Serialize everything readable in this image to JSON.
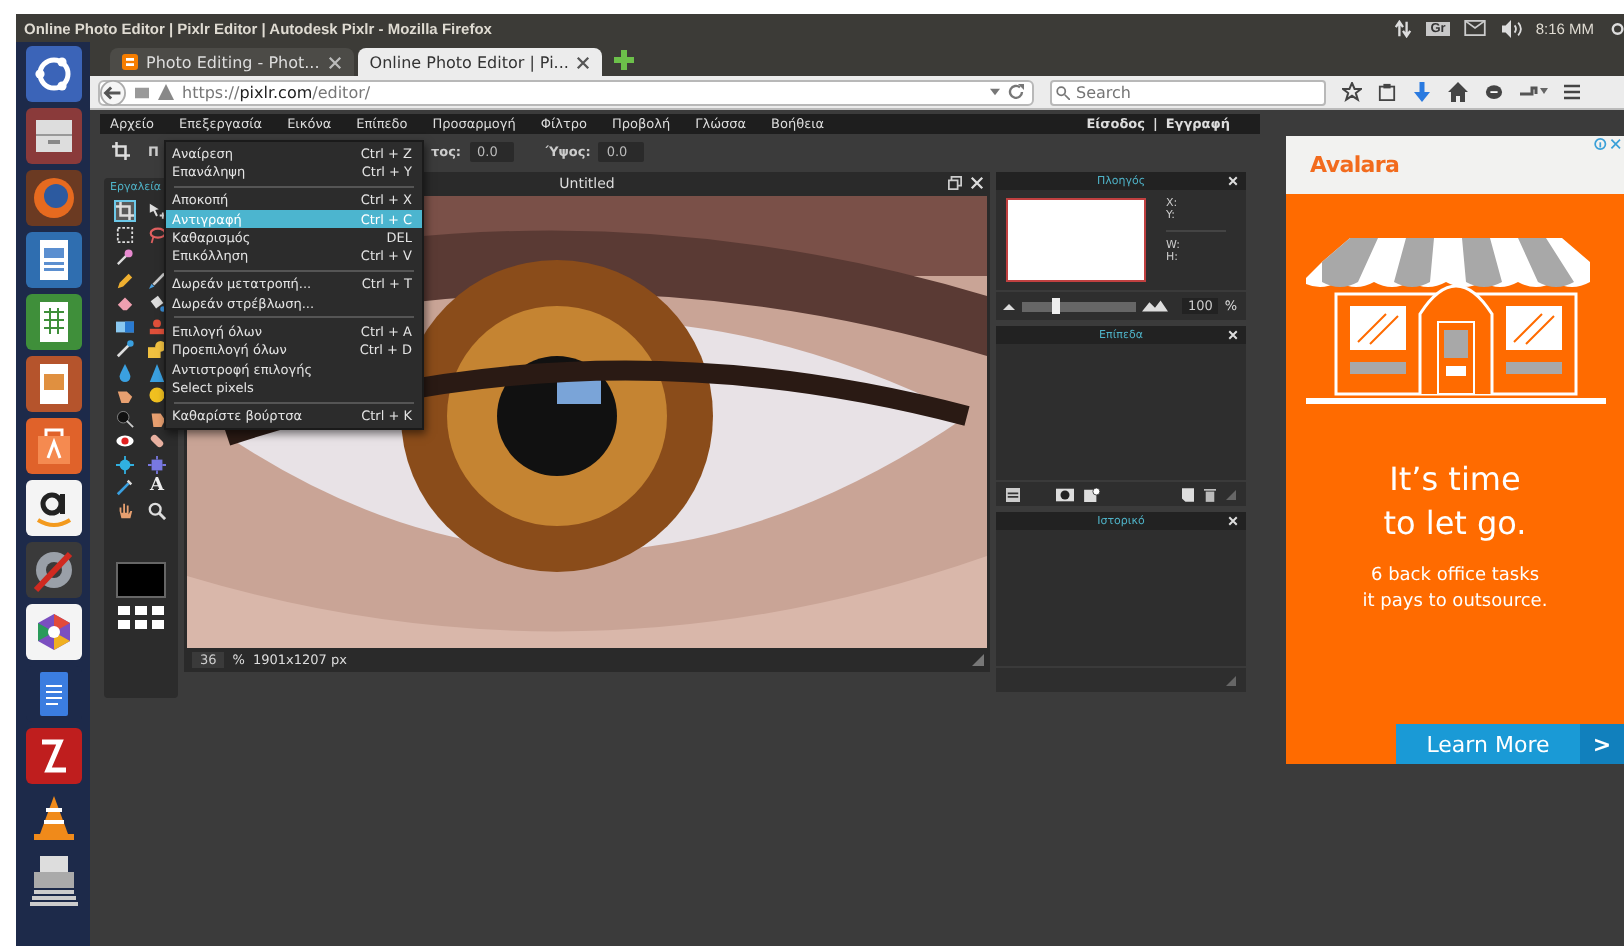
{
  "os_bar": {
    "title": "Online Photo Editor | Pixlr Editor | Autodesk Pixlr - Mozilla Firefox",
    "keyboard": "Gr",
    "clock": "8:16 ΜΜ"
  },
  "browser": {
    "tabs": [
      {
        "label": "Photo Editing - Phot...",
        "selected": false
      },
      {
        "label": "Online Photo Editor | Pi...",
        "selected": true
      }
    ],
    "url": {
      "scheme": "https://",
      "host": "pixlr.com",
      "path": "/editor/"
    },
    "search": {
      "placeholder": "Search"
    }
  },
  "editor": {
    "menubar": [
      "Αρχείο",
      "Επεξεργασία",
      "Εικόνα",
      "Επίπεδο",
      "Προσαρμογή",
      "Φίλτρο",
      "Προβολή",
      "Γλώσσα",
      "Βοήθεια"
    ],
    "account": {
      "login": "Είσοδος",
      "divider": "|",
      "register": "Εγγραφή"
    },
    "options": {
      "label_1": "Π",
      "label_2": "τος:",
      "value_1": "0.0",
      "label_3": "Ύψος:",
      "value_2": "0.0"
    },
    "tools_title": "Εργαλεία",
    "tool_rows": [
      [
        {
          "kind": "crop",
          "selected": true
        },
        {
          "kind": "move",
          "selected": false
        }
      ],
      [
        {
          "kind": "marquee",
          "selected": false
        },
        {
          "kind": "lasso",
          "selected": false
        }
      ],
      [
        {
          "kind": "wand",
          "selected": false
        }
      ],
      [
        {
          "kind": "pencil",
          "selected": false
        },
        {
          "kind": "brush",
          "selected": false
        }
      ],
      [
        {
          "kind": "eraser",
          "selected": false
        },
        {
          "kind": "bucket",
          "selected": false
        }
      ],
      [
        {
          "kind": "gradient",
          "selected": false
        },
        {
          "kind": "stamp",
          "selected": false
        }
      ],
      [
        {
          "kind": "replace",
          "selected": false
        },
        {
          "kind": "shape",
          "selected": false
        }
      ],
      [
        {
          "kind": "blur",
          "selected": false
        },
        {
          "kind": "sharpen",
          "selected": false
        }
      ],
      [
        {
          "kind": "smudge",
          "selected": false
        },
        {
          "kind": "sponge",
          "selected": false
        }
      ],
      [
        {
          "kind": "dodge",
          "selected": false
        },
        {
          "kind": "burn",
          "selected": false
        }
      ],
      [
        {
          "kind": "redeye",
          "selected": false
        },
        {
          "kind": "heal",
          "selected": false
        }
      ],
      [
        {
          "kind": "bloat",
          "selected": false
        },
        {
          "kind": "pinch",
          "selected": false
        }
      ],
      [
        {
          "kind": "picker",
          "selected": false
        },
        {
          "kind": "type",
          "glyph": "A",
          "selected": false
        }
      ],
      [
        {
          "kind": "hand",
          "selected": false
        },
        {
          "kind": "zoom",
          "selected": false
        }
      ]
    ],
    "canvas": {
      "title": "Untitled",
      "zoom": "36",
      "zoom_unit": "%",
      "size": "1901x1207 px"
    },
    "navigator": {
      "title": "Πλοηγός",
      "x": "X:",
      "y": "Y:",
      "w": "W:",
      "h": "H:",
      "zoom": {
        "level": 0.3
      },
      "zoom_value": "100",
      "zoom_unit": "%"
    },
    "layers": {
      "title": "Επίπεδα"
    },
    "history": {
      "title": "Ιστορικό"
    },
    "edit_menu": [
      [
        {
          "label": "Αναίρεση",
          "shortcut": "Ctrl + Z",
          "selected": false
        },
        {
          "label": "Επανάληψη",
          "shortcut": "Ctrl + Y",
          "selected": false
        }
      ],
      [
        {
          "label": "Αποκοπή",
          "shortcut": "Ctrl + X",
          "selected": false
        },
        {
          "label": "Αντιγραφή",
          "shortcut": "Ctrl + C",
          "selected": true
        },
        {
          "label": "Καθαρισμός",
          "shortcut": "DEL",
          "selected": false
        },
        {
          "label": "Επικόλληση",
          "shortcut": "Ctrl + V",
          "selected": false
        }
      ],
      [
        {
          "label": "Δωρεάν μετατροπή...",
          "shortcut": "Ctrl + T",
          "selected": false
        },
        {
          "label": "Δωρεάν στρέβλωση...",
          "selected": false
        }
      ],
      [
        {
          "label": "Επιλογή όλων",
          "shortcut": "Ctrl + A",
          "selected": false
        },
        {
          "label": "Προεπιλογή όλων",
          "shortcut": "Ctrl + D",
          "selected": false
        },
        {
          "label": "Αντιστροφή επιλογής",
          "selected": false
        },
        {
          "label": "Select pixels",
          "selected": false
        }
      ],
      [
        {
          "label": "Καθαρίστε βούρτσα",
          "shortcut": "Ctrl + K",
          "selected": false
        }
      ]
    ]
  },
  "ad": {
    "logo": "Avalara",
    "headline": "It’s time to let go.",
    "text": "6 back office tasks\nit pays to outsource.",
    "button": "Learn More",
    "arrow": ">"
  }
}
